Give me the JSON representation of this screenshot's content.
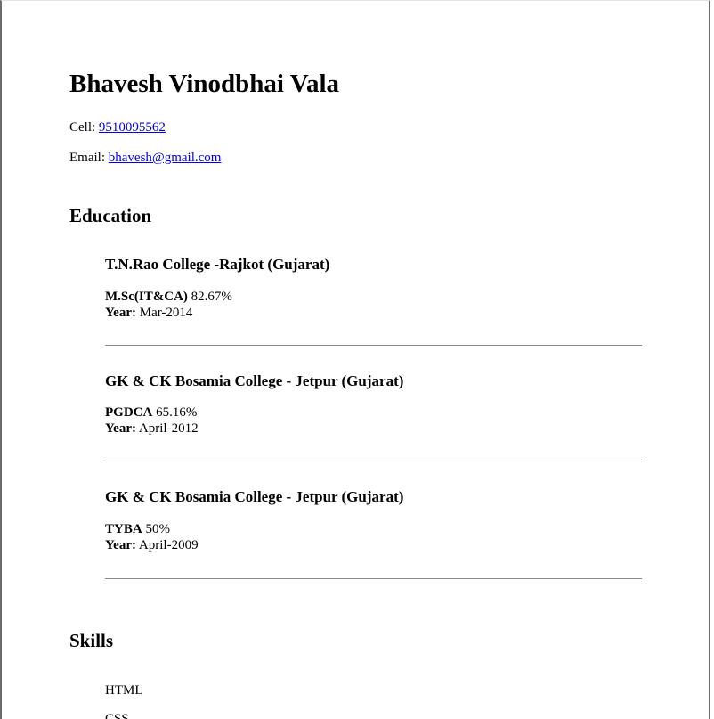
{
  "resume": {
    "name": "Bhavesh Vinodbhai Vala",
    "cell_label": "Cell: ",
    "cell_value": "9510095562",
    "email_label": "Email: ",
    "email_value": "bhavesh@gmail.com"
  },
  "education": {
    "title": "Education",
    "entries": [
      {
        "school": "T.N.Rao College -Rajkot (Gujarat)",
        "degree": "M.Sc(IT&CA)",
        "score": " 82.67%",
        "year_label": "Year:",
        "year": " Mar-2014"
      },
      {
        "school": "GK & CK Bosamia College - Jetpur (Gujarat)",
        "degree": "PGDCA",
        "score": " 65.16%",
        "year_label": "Year:",
        "year": " April-2012"
      },
      {
        "school": "GK & CK Bosamia College - Jetpur (Gujarat)",
        "degree": "TYBA",
        "score": " 50%",
        "year_label": "Year:",
        "year": " April-2009"
      }
    ]
  },
  "skills": {
    "title": "Skills",
    "items": [
      "HTML",
      "CSS"
    ]
  },
  "colors": {
    "link": "#0000ee",
    "rule": "#8a8a8a",
    "frame_border": "#6b6b6b"
  }
}
